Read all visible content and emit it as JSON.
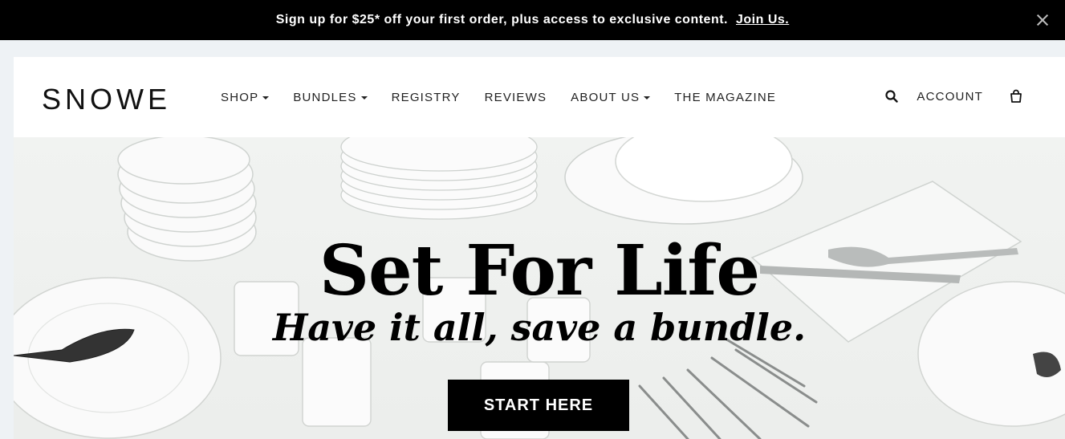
{
  "promo": {
    "message": "Sign up for $25* off your first order, plus access to exclusive content.",
    "link_label": "Join Us."
  },
  "header": {
    "logo": "SNOWE",
    "nav": [
      {
        "label": "SHOP",
        "has_dropdown": true
      },
      {
        "label": "BUNDLES",
        "has_dropdown": true
      },
      {
        "label": "REGISTRY",
        "has_dropdown": false
      },
      {
        "label": "REVIEWS",
        "has_dropdown": false
      },
      {
        "label": "ABOUT US",
        "has_dropdown": true
      },
      {
        "label": "THE MAGAZINE",
        "has_dropdown": false
      }
    ],
    "account_label": "ACCOUNT",
    "icons": {
      "search": "search-icon",
      "cart": "shopping-bag-icon",
      "close": "close-icon"
    }
  },
  "hero": {
    "title": "Set For Life",
    "subtitle": "Have it all, save a bundle.",
    "cta_label": "START HERE"
  },
  "colors": {
    "promo_bg": "#000000",
    "header_bg": "#ffffff",
    "cta_bg": "#000000",
    "page_bg": "#eef2f5"
  }
}
